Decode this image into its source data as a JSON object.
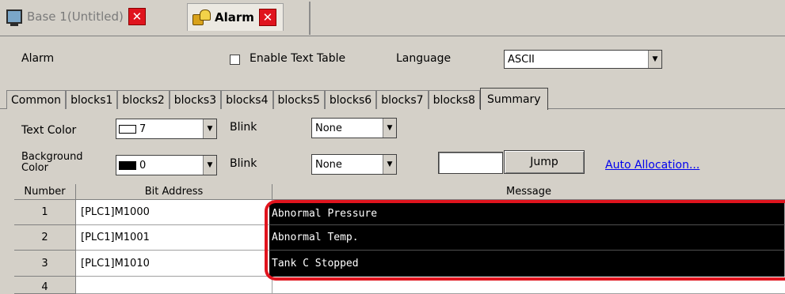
{
  "doc_tabs": [
    {
      "label": "Base 1(Untitled)",
      "icon": "screen-icon",
      "active": false
    },
    {
      "label": "Alarm",
      "icon": "alarm-icon",
      "active": true
    }
  ],
  "close_glyph": "✕",
  "settings": {
    "title": "Alarm",
    "enable_text_table_label": "Enable Text Table",
    "language_label": "Language",
    "language_value": "ASCII"
  },
  "tabs": [
    "Common",
    "blocks1",
    "blocks2",
    "blocks3",
    "blocks4",
    "blocks5",
    "blocks6",
    "blocks7",
    "blocks8",
    "Summary"
  ],
  "selected_tab": "Summary",
  "colors": {
    "text_color_label": "Text Color",
    "text_color_value": "7",
    "background_color_label": "Background Color",
    "background_color_value": "0",
    "blink_label": "Blink",
    "blink_text_value": "None",
    "blink_bg_value": "None",
    "jump_label": "Jump",
    "auto_allocation_label": "Auto Allocation...",
    "accent_red": "#e0141e",
    "link_blue": "#0000ee"
  },
  "table": {
    "columns": [
      "Number",
      "Bit Address",
      "Message"
    ],
    "rows": [
      {
        "number": "1",
        "address": "[PLC1]M1000",
        "message": "Abnormal Pressure"
      },
      {
        "number": "2",
        "address": "[PLC1]M1001",
        "message": "Abnormal Temp."
      },
      {
        "number": "3",
        "address": "[PLC1]M1010",
        "message": "Tank C Stopped"
      },
      {
        "number": "4",
        "address": "",
        "message": ""
      }
    ]
  }
}
